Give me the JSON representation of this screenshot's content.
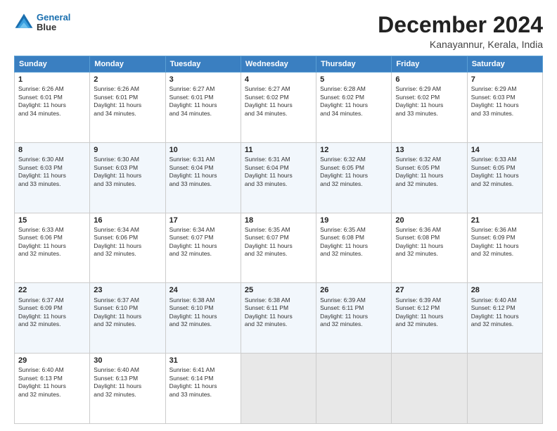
{
  "header": {
    "logo_line1": "General",
    "logo_line2": "Blue",
    "title": "December 2024",
    "subtitle": "Kanayannur, Kerala, India"
  },
  "calendar": {
    "days_of_week": [
      "Sunday",
      "Monday",
      "Tuesday",
      "Wednesday",
      "Thursday",
      "Friday",
      "Saturday"
    ],
    "weeks": [
      [
        {
          "day": "1",
          "info": "Sunrise: 6:26 AM\nSunset: 6:01 PM\nDaylight: 11 hours\nand 34 minutes."
        },
        {
          "day": "2",
          "info": "Sunrise: 6:26 AM\nSunset: 6:01 PM\nDaylight: 11 hours\nand 34 minutes."
        },
        {
          "day": "3",
          "info": "Sunrise: 6:27 AM\nSunset: 6:01 PM\nDaylight: 11 hours\nand 34 minutes."
        },
        {
          "day": "4",
          "info": "Sunrise: 6:27 AM\nSunset: 6:02 PM\nDaylight: 11 hours\nand 34 minutes."
        },
        {
          "day": "5",
          "info": "Sunrise: 6:28 AM\nSunset: 6:02 PM\nDaylight: 11 hours\nand 34 minutes."
        },
        {
          "day": "6",
          "info": "Sunrise: 6:29 AM\nSunset: 6:02 PM\nDaylight: 11 hours\nand 33 minutes."
        },
        {
          "day": "7",
          "info": "Sunrise: 6:29 AM\nSunset: 6:03 PM\nDaylight: 11 hours\nand 33 minutes."
        }
      ],
      [
        {
          "day": "8",
          "info": "Sunrise: 6:30 AM\nSunset: 6:03 PM\nDaylight: 11 hours\nand 33 minutes."
        },
        {
          "day": "9",
          "info": "Sunrise: 6:30 AM\nSunset: 6:03 PM\nDaylight: 11 hours\nand 33 minutes."
        },
        {
          "day": "10",
          "info": "Sunrise: 6:31 AM\nSunset: 6:04 PM\nDaylight: 11 hours\nand 33 minutes."
        },
        {
          "day": "11",
          "info": "Sunrise: 6:31 AM\nSunset: 6:04 PM\nDaylight: 11 hours\nand 33 minutes."
        },
        {
          "day": "12",
          "info": "Sunrise: 6:32 AM\nSunset: 6:05 PM\nDaylight: 11 hours\nand 32 minutes."
        },
        {
          "day": "13",
          "info": "Sunrise: 6:32 AM\nSunset: 6:05 PM\nDaylight: 11 hours\nand 32 minutes."
        },
        {
          "day": "14",
          "info": "Sunrise: 6:33 AM\nSunset: 6:05 PM\nDaylight: 11 hours\nand 32 minutes."
        }
      ],
      [
        {
          "day": "15",
          "info": "Sunrise: 6:33 AM\nSunset: 6:06 PM\nDaylight: 11 hours\nand 32 minutes."
        },
        {
          "day": "16",
          "info": "Sunrise: 6:34 AM\nSunset: 6:06 PM\nDaylight: 11 hours\nand 32 minutes."
        },
        {
          "day": "17",
          "info": "Sunrise: 6:34 AM\nSunset: 6:07 PM\nDaylight: 11 hours\nand 32 minutes."
        },
        {
          "day": "18",
          "info": "Sunrise: 6:35 AM\nSunset: 6:07 PM\nDaylight: 11 hours\nand 32 minutes."
        },
        {
          "day": "19",
          "info": "Sunrise: 6:35 AM\nSunset: 6:08 PM\nDaylight: 11 hours\nand 32 minutes."
        },
        {
          "day": "20",
          "info": "Sunrise: 6:36 AM\nSunset: 6:08 PM\nDaylight: 11 hours\nand 32 minutes."
        },
        {
          "day": "21",
          "info": "Sunrise: 6:36 AM\nSunset: 6:09 PM\nDaylight: 11 hours\nand 32 minutes."
        }
      ],
      [
        {
          "day": "22",
          "info": "Sunrise: 6:37 AM\nSunset: 6:09 PM\nDaylight: 11 hours\nand 32 minutes."
        },
        {
          "day": "23",
          "info": "Sunrise: 6:37 AM\nSunset: 6:10 PM\nDaylight: 11 hours\nand 32 minutes."
        },
        {
          "day": "24",
          "info": "Sunrise: 6:38 AM\nSunset: 6:10 PM\nDaylight: 11 hours\nand 32 minutes."
        },
        {
          "day": "25",
          "info": "Sunrise: 6:38 AM\nSunset: 6:11 PM\nDaylight: 11 hours\nand 32 minutes."
        },
        {
          "day": "26",
          "info": "Sunrise: 6:39 AM\nSunset: 6:11 PM\nDaylight: 11 hours\nand 32 minutes."
        },
        {
          "day": "27",
          "info": "Sunrise: 6:39 AM\nSunset: 6:12 PM\nDaylight: 11 hours\nand 32 minutes."
        },
        {
          "day": "28",
          "info": "Sunrise: 6:40 AM\nSunset: 6:12 PM\nDaylight: 11 hours\nand 32 minutes."
        }
      ],
      [
        {
          "day": "29",
          "info": "Sunrise: 6:40 AM\nSunset: 6:13 PM\nDaylight: 11 hours\nand 32 minutes."
        },
        {
          "day": "30",
          "info": "Sunrise: 6:40 AM\nSunset: 6:13 PM\nDaylight: 11 hours\nand 32 minutes."
        },
        {
          "day": "31",
          "info": "Sunrise: 6:41 AM\nSunset: 6:14 PM\nDaylight: 11 hours\nand 33 minutes."
        },
        {
          "day": "",
          "info": ""
        },
        {
          "day": "",
          "info": ""
        },
        {
          "day": "",
          "info": ""
        },
        {
          "day": "",
          "info": ""
        }
      ]
    ]
  }
}
